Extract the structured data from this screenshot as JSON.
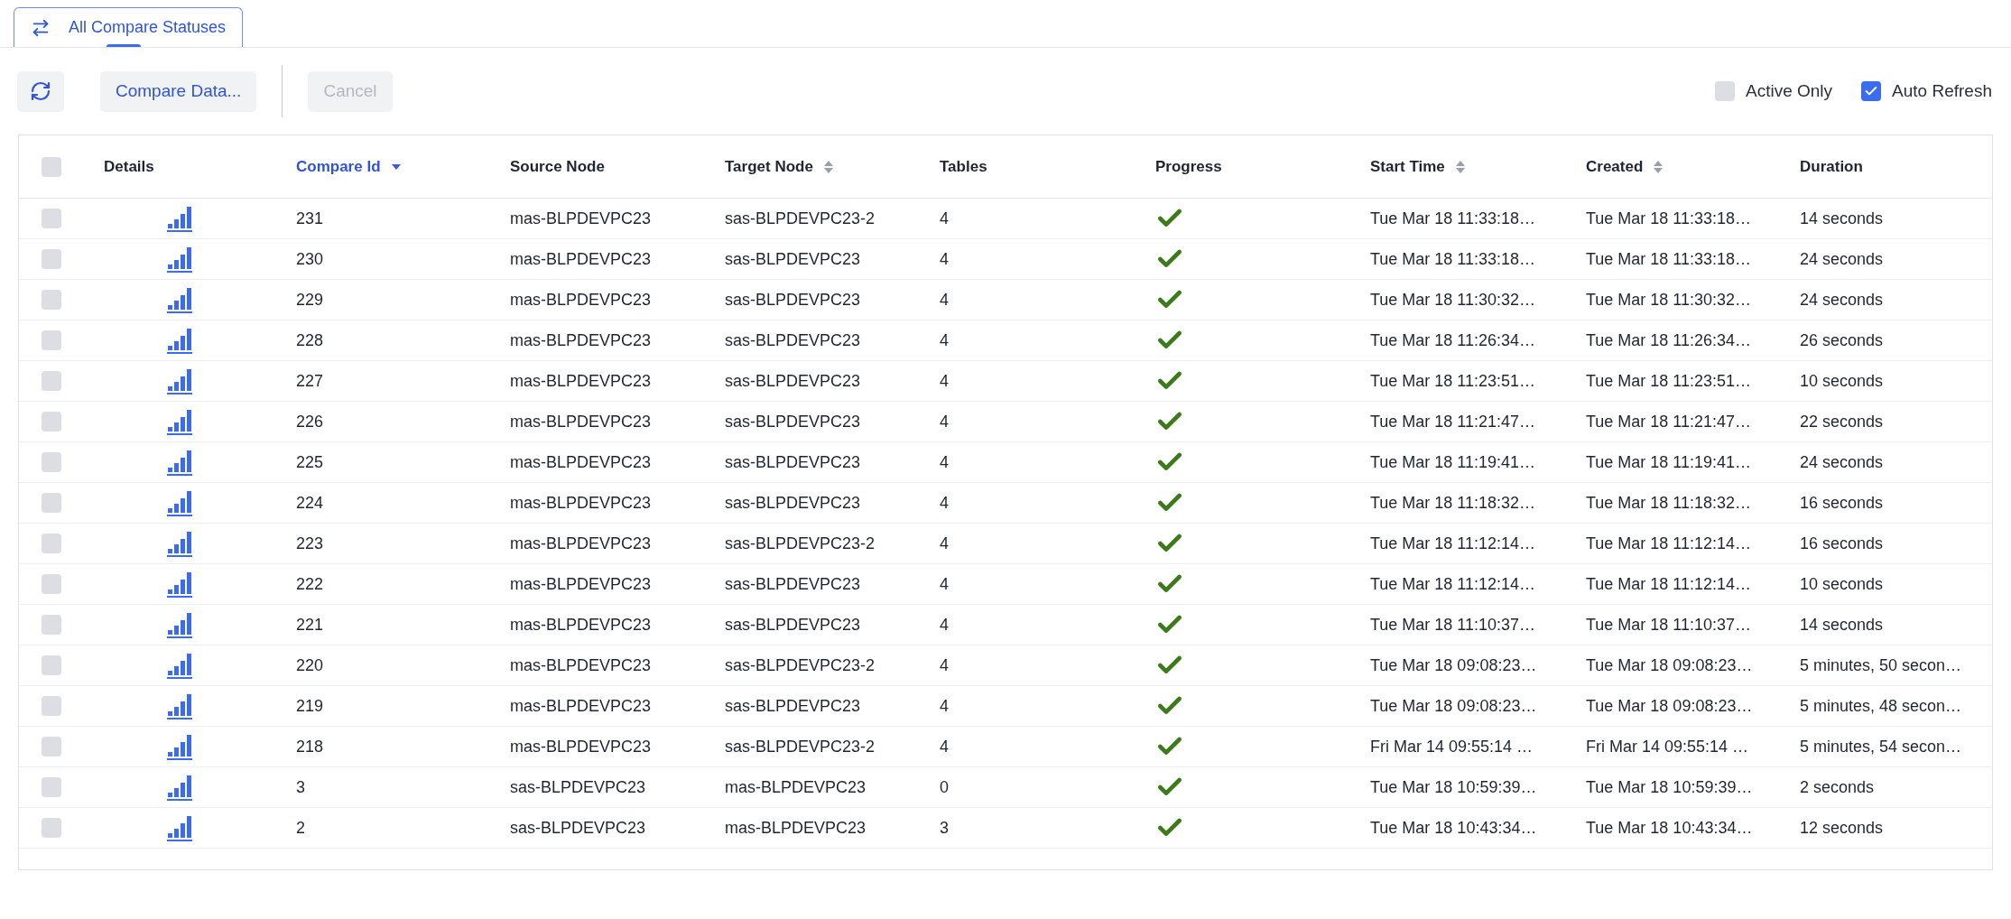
{
  "tabs": [
    {
      "label": "All Compare Statuses",
      "selected": true
    }
  ],
  "toolbar": {
    "buttons": [
      {
        "kind": "refresh",
        "disabled": false
      },
      {
        "kind": "text",
        "label": "Compare Data...",
        "disabled": false
      },
      {
        "kind": "text",
        "label": "Cancel",
        "disabled": true
      }
    ],
    "toggles": [
      {
        "label": "Active Only",
        "checked": false
      },
      {
        "label": "Auto Refresh",
        "checked": true
      }
    ]
  },
  "table": {
    "select_all": {
      "checked": false
    },
    "columns": [
      {
        "label": "Details",
        "kind": "plain"
      },
      {
        "label": "Compare Id",
        "kind": "sorted"
      },
      {
        "label": "Source Node",
        "kind": "plain"
      },
      {
        "label": "Target Node",
        "kind": "sortable"
      },
      {
        "label": "Tables",
        "kind": "plain"
      },
      {
        "label": "Progress",
        "kind": "plain"
      },
      {
        "label": "Start Time",
        "kind": "sortable"
      },
      {
        "label": "Created",
        "kind": "sortable"
      },
      {
        "label": "Duration",
        "kind": "plain"
      }
    ],
    "rows": [
      {
        "checked": false,
        "id": "231",
        "source": "mas-BLPDEVPC23",
        "target": "sas-BLPDEVPC23-2",
        "tables": "4",
        "complete": true,
        "start": "Tue Mar 18 11:33:18…",
        "created": "Tue Mar 18 11:33:18…",
        "duration": "14 seconds"
      },
      {
        "checked": false,
        "id": "230",
        "source": "mas-BLPDEVPC23",
        "target": "sas-BLPDEVPC23",
        "tables": "4",
        "complete": true,
        "start": "Tue Mar 18 11:33:18…",
        "created": "Tue Mar 18 11:33:18…",
        "duration": "24 seconds"
      },
      {
        "checked": false,
        "id": "229",
        "source": "mas-BLPDEVPC23",
        "target": "sas-BLPDEVPC23",
        "tables": "4",
        "complete": true,
        "start": "Tue Mar 18 11:30:32…",
        "created": "Tue Mar 18 11:30:32…",
        "duration": "24 seconds"
      },
      {
        "checked": false,
        "id": "228",
        "source": "mas-BLPDEVPC23",
        "target": "sas-BLPDEVPC23",
        "tables": "4",
        "complete": true,
        "start": "Tue Mar 18 11:26:34…",
        "created": "Tue Mar 18 11:26:34…",
        "duration": "26 seconds"
      },
      {
        "checked": false,
        "id": "227",
        "source": "mas-BLPDEVPC23",
        "target": "sas-BLPDEVPC23",
        "tables": "4",
        "complete": true,
        "start": "Tue Mar 18 11:23:51…",
        "created": "Tue Mar 18 11:23:51…",
        "duration": "10 seconds"
      },
      {
        "checked": false,
        "id": "226",
        "source": "mas-BLPDEVPC23",
        "target": "sas-BLPDEVPC23",
        "tables": "4",
        "complete": true,
        "start": "Tue Mar 18 11:21:47…",
        "created": "Tue Mar 18 11:21:47…",
        "duration": "22 seconds"
      },
      {
        "checked": false,
        "id": "225",
        "source": "mas-BLPDEVPC23",
        "target": "sas-BLPDEVPC23",
        "tables": "4",
        "complete": true,
        "start": "Tue Mar 18 11:19:41…",
        "created": "Tue Mar 18 11:19:41…",
        "duration": "24 seconds"
      },
      {
        "checked": false,
        "id": "224",
        "source": "mas-BLPDEVPC23",
        "target": "sas-BLPDEVPC23",
        "tables": "4",
        "complete": true,
        "start": "Tue Mar 18 11:18:32…",
        "created": "Tue Mar 18 11:18:32…",
        "duration": "16 seconds"
      },
      {
        "checked": false,
        "id": "223",
        "source": "mas-BLPDEVPC23",
        "target": "sas-BLPDEVPC23-2",
        "tables": "4",
        "complete": true,
        "start": "Tue Mar 18 11:12:14…",
        "created": "Tue Mar 18 11:12:14…",
        "duration": "16 seconds"
      },
      {
        "checked": false,
        "id": "222",
        "source": "mas-BLPDEVPC23",
        "target": "sas-BLPDEVPC23",
        "tables": "4",
        "complete": true,
        "start": "Tue Mar 18 11:12:14…",
        "created": "Tue Mar 18 11:12:14…",
        "duration": "10 seconds"
      },
      {
        "checked": false,
        "id": "221",
        "source": "mas-BLPDEVPC23",
        "target": "sas-BLPDEVPC23",
        "tables": "4",
        "complete": true,
        "start": "Tue Mar 18 11:10:37…",
        "created": "Tue Mar 18 11:10:37…",
        "duration": "14 seconds"
      },
      {
        "checked": false,
        "id": "220",
        "source": "mas-BLPDEVPC23",
        "target": "sas-BLPDEVPC23-2",
        "tables": "4",
        "complete": true,
        "start": "Tue Mar 18 09:08:23…",
        "created": "Tue Mar 18 09:08:23…",
        "duration": "5 minutes, 50 secon…"
      },
      {
        "checked": false,
        "id": "219",
        "source": "mas-BLPDEVPC23",
        "target": "sas-BLPDEVPC23",
        "tables": "4",
        "complete": true,
        "start": "Tue Mar 18 09:08:23…",
        "created": "Tue Mar 18 09:08:23…",
        "duration": "5 minutes, 48 secon…"
      },
      {
        "checked": false,
        "id": "218",
        "source": "mas-BLPDEVPC23",
        "target": "sas-BLPDEVPC23-2",
        "tables": "4",
        "complete": true,
        "start": "Fri Mar 14 09:55:14 …",
        "created": "Fri Mar 14 09:55:14 …",
        "duration": "5 minutes, 54 secon…"
      },
      {
        "checked": false,
        "id": "3",
        "source": "sas-BLPDEVPC23",
        "target": "mas-BLPDEVPC23",
        "tables": "0",
        "complete": true,
        "start": "Tue Mar 18 10:59:39…",
        "created": "Tue Mar 18 10:59:39…",
        "duration": "2 seconds"
      },
      {
        "checked": false,
        "id": "2",
        "source": "sas-BLPDEVPC23",
        "target": "mas-BLPDEVPC23",
        "tables": "3",
        "complete": true,
        "start": "Tue Mar 18 10:43:34…",
        "created": "Tue Mar 18 10:43:34…",
        "duration": "12 seconds"
      }
    ]
  }
}
